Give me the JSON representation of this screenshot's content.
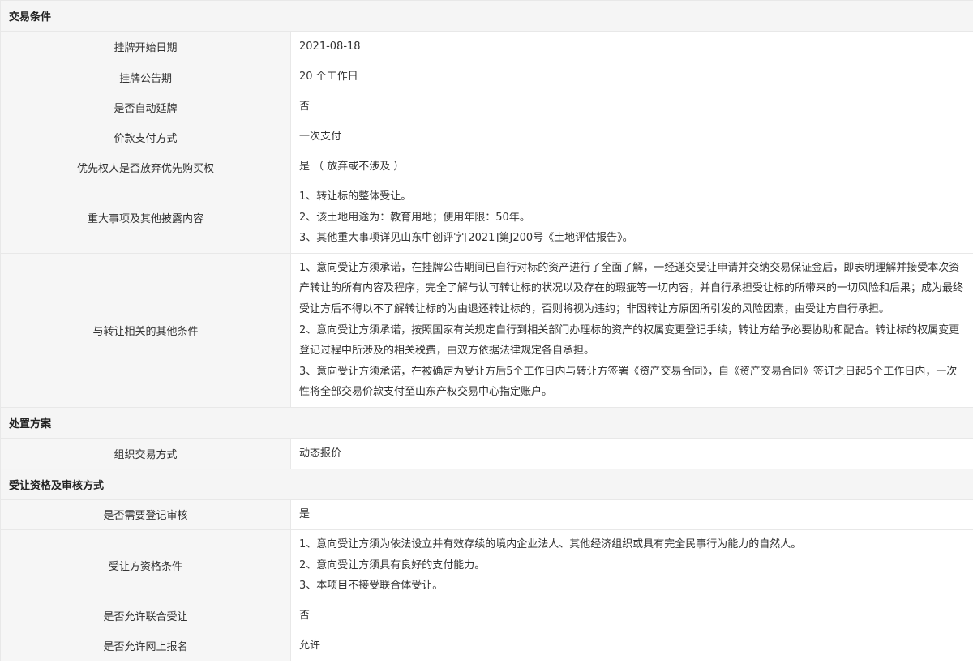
{
  "sections": {
    "trade_conditions": {
      "title": "交易条件"
    },
    "disposal_plan": {
      "title": "处置方案"
    },
    "qualification": {
      "title": "受让资格及审核方式"
    }
  },
  "rows": {
    "listing_start": {
      "label": "挂牌开始日期",
      "value": "2021-08-18"
    },
    "listing_period": {
      "label": "挂牌公告期",
      "value": "20 个工作日"
    },
    "auto_extend": {
      "label": "是否自动延牌",
      "value": "否"
    },
    "payment_method": {
      "label": "价款支付方式",
      "value": "一次支付"
    },
    "preemptive_right": {
      "label": "优先权人是否放弃优先购买权",
      "value": "是 （ 放弃或不涉及 ）"
    },
    "major_matters": {
      "label": "重大事项及其他披露内容",
      "lines": [
        "1、转让标的整体受让。",
        "2、该土地用途为：教育用地；使用年限：50年。",
        "3、其他重大事项详见山东中创评字[2021]第J200号《土地评估报告》。"
      ]
    },
    "other_conditions": {
      "label": "与转让相关的其他条件",
      "lines": [
        "1、意向受让方须承诺，在挂牌公告期间已自行对标的资产进行了全面了解，一经递交受让申请并交纳交易保证金后，即表明理解并接受本次资产转让的所有内容及程序，完全了解与认可转让标的状况以及存在的瑕疵等一切内容，并自行承担受让标的所带来的一切风险和后果；成为最终受让方后不得以不了解转让标的为由退还转让标的，否则将视为违约；非因转让方原因所引发的风险因素，由受让方自行承担。",
        "2、意向受让方须承诺，按照国家有关规定自行到相关部门办理标的资产的权属变更登记手续，转让方给予必要协助和配合。转让标的权属变更登记过程中所涉及的相关税费，由双方依据法律规定各自承担。",
        "3、意向受让方须承诺，在被确定为受让方后5个工作日内与转让方签署《资产交易合同》，自《资产交易合同》签订之日起5个工作日内，一次性将全部交易价款支付至山东产权交易中心指定账户。"
      ]
    },
    "organize_method": {
      "label": "组织交易方式",
      "value": "动态报价"
    },
    "registration_review": {
      "label": "是否需要登记审核",
      "value": "是"
    },
    "transferee_qualification": {
      "label": "受让方资格条件",
      "lines": [
        "1、意向受让方须为依法设立并有效存续的境内企业法人、其他经济组织或具有完全民事行为能力的自然人。",
        "2、意向受让方须具有良好的支付能力。",
        "3、本项目不接受联合体受让。"
      ]
    },
    "joint_transfer": {
      "label": "是否允许联合受让",
      "value": "否"
    },
    "online_registration": {
      "label": "是否允许网上报名",
      "value": "允许"
    }
  }
}
